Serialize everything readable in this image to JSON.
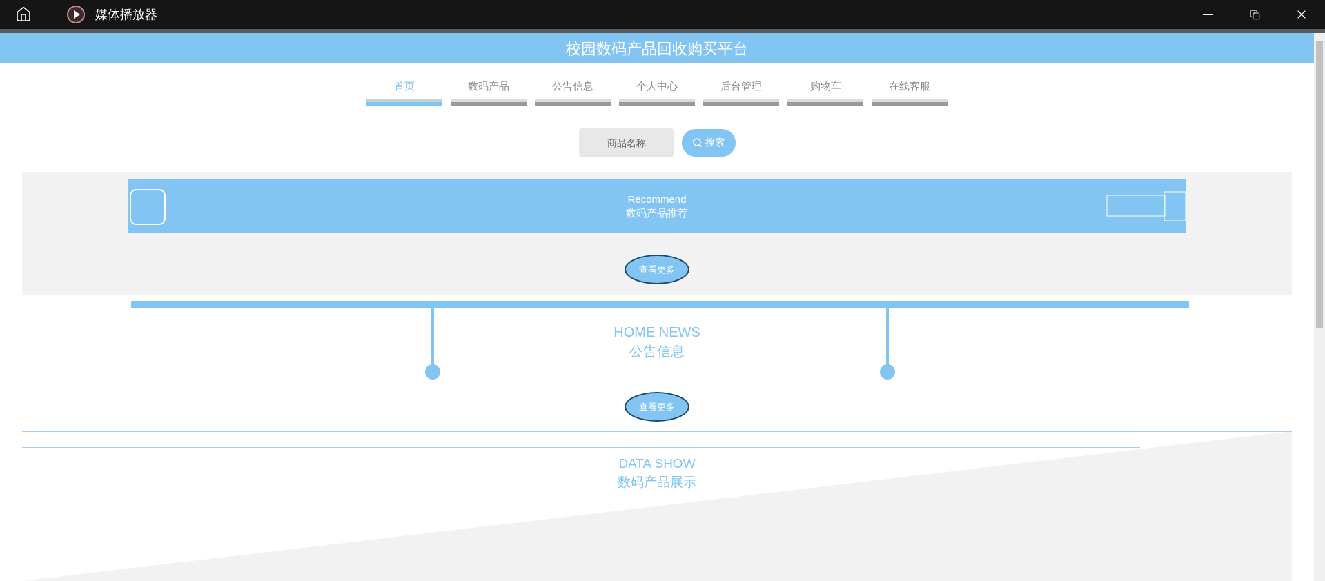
{
  "window": {
    "title": "媒体播放器"
  },
  "site_title": "校园数码产品回收购买平台",
  "nav": [
    {
      "label": "首页",
      "selected": true
    },
    {
      "label": "数码产品",
      "selected": false
    },
    {
      "label": "公告信息",
      "selected": false
    },
    {
      "label": "个人中心",
      "selected": false
    },
    {
      "label": "后台管理",
      "selected": false
    },
    {
      "label": "购物车",
      "selected": false
    },
    {
      "label": "在线客服",
      "selected": false
    }
  ],
  "search": {
    "placeholder": "商品名称",
    "button": "搜索"
  },
  "recommend": {
    "title_en": "Recommend",
    "title": "数码产品推荐",
    "more": "查看更多"
  },
  "news": {
    "title_en": "HOME NEWS",
    "title": "公告信息",
    "more": "查看更多"
  },
  "data_show": {
    "title_en": "DATA SHOW",
    "title": "数码产品展示"
  }
}
